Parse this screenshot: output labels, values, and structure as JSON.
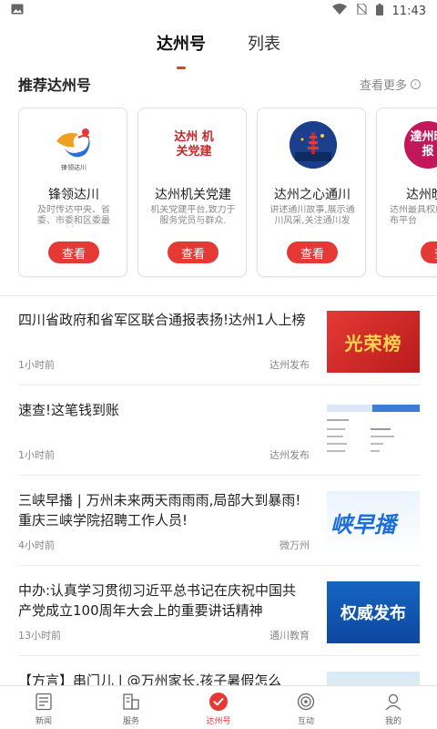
{
  "status_bar": {
    "time": "11:43"
  },
  "top_tabs": [
    {
      "label": "达州号",
      "active": true
    },
    {
      "label": "列表",
      "active": false
    }
  ],
  "section": {
    "title": "推荐达州号",
    "see_more": "查看更多"
  },
  "cards": [
    {
      "name": "锋领达川",
      "desc": "及时传达中央、省委、市委和区委最新...",
      "button": "查看",
      "logo_text": "锋领达川"
    },
    {
      "name": "达州机关党建",
      "desc": "机关党建平台,致力于服务党员与群众.",
      "button": "查看",
      "logo_text": "达州 机关党建"
    },
    {
      "name": "达州之心通川",
      "desc": "讲述通川故事,展示通川风采,关注通川发展.",
      "button": "查看"
    },
    {
      "name": "达州晚报",
      "desc": "达州最具权威... 闻发布平台",
      "button": "查看",
      "logo_text": "達州晚报"
    }
  ],
  "news": [
    {
      "title": "四川省政府和省军区联合通报表扬!达州1人上榜",
      "time": "1小时前",
      "source": "达州发布",
      "thumb_text": "光荣榜"
    },
    {
      "title": "速查!这笔钱到账",
      "time": "1小时前",
      "source": "达州发布"
    },
    {
      "title": "三峡早播 | 万州未来两天雨雨雨,局部大到暴雨!重庆三峡学院招聘工作人员!",
      "time": "4小时前",
      "source": "微万州",
      "thumb_text": "峡早播"
    },
    {
      "title": "中办:认真学习贯彻习近平总书记在庆祝中国共产党成立100周年大会上的重要讲话精神",
      "time": "13小时前",
      "source": "通川教育",
      "thumb_text": "权威发布"
    },
    {
      "title": "【方言】串门儿 | @万州家长,孩子暑假怎么",
      "time": "",
      "source": ""
    }
  ],
  "bottom_nav": [
    {
      "label": "新闻",
      "icon": "news-icon",
      "active": false
    },
    {
      "label": "服务",
      "icon": "service-icon",
      "active": false
    },
    {
      "label": "达州号",
      "icon": "check-circle-icon",
      "active": true
    },
    {
      "label": "互动",
      "icon": "interact-icon",
      "active": false
    },
    {
      "label": "我的",
      "icon": "profile-icon",
      "active": false
    }
  ],
  "colors": {
    "accent": "#e53935",
    "text": "#222222",
    "muted": "#888888"
  }
}
